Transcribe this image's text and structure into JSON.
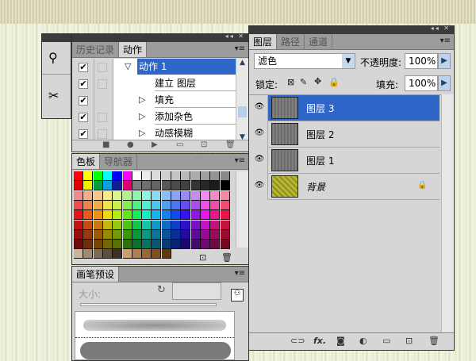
{
  "tools_strip": {
    "icons": [
      "usb-icon",
      "tools-icon"
    ]
  },
  "actions_panel": {
    "tabs": [
      {
        "label": "历史记录",
        "active": false
      },
      {
        "label": "动作",
        "active": true
      }
    ],
    "items": [
      {
        "label": "动作 1",
        "indent": 0,
        "expanded": true,
        "selected": true,
        "checked": true,
        "dialog": true
      },
      {
        "label": "建立 图层",
        "indent": 1,
        "expanded": null,
        "selected": false,
        "checked": true,
        "dialog": true
      },
      {
        "label": "填充",
        "indent": 1,
        "expanded": false,
        "selected": false,
        "checked": true,
        "dialog": false
      },
      {
        "label": "添加杂色",
        "indent": 1,
        "expanded": false,
        "selected": false,
        "checked": true,
        "dialog": true
      },
      {
        "label": "动感模糊",
        "indent": 1,
        "expanded": false,
        "selected": false,
        "checked": true,
        "dialog": true
      }
    ],
    "toolbar": [
      "stop-icon",
      "record-icon",
      "play-icon",
      "new-set-icon",
      "new-action-icon",
      "delete-icon"
    ]
  },
  "swatches_panel": {
    "tabs": [
      {
        "label": "色板",
        "active": true
      },
      {
        "label": "导航器",
        "active": false
      }
    ],
    "row1": [
      "#ff0000",
      "#ffff00",
      "#00ff00",
      "#00ffff",
      "#0000ff",
      "#ff00ff",
      "#ffffff",
      "#ececec",
      "#dcdcdc",
      "#d0d0d0",
      "#c4c4c4",
      "#b8b8b8",
      "#acacac",
      "#a0a0a0",
      "#949494",
      "#888888"
    ],
    "row2": [
      "#e00000",
      "#f0f000",
      "#00a040",
      "#10a0e0",
      "#102090",
      "#e0006e",
      "#7c7c7c",
      "#707070",
      "#646464",
      "#585858",
      "#4c4c4c",
      "#404040",
      "#343434",
      "#282828",
      "#1c1c1c",
      "#000000"
    ],
    "hues": [
      0,
      20,
      35,
      55,
      75,
      100,
      140,
      170,
      195,
      210,
      225,
      250,
      275,
      300,
      325,
      345
    ],
    "row_lightness": [
      75,
      62,
      50,
      42,
      32,
      24
    ],
    "browns": [
      "#c8b49a",
      "#a08a74",
      "#7a6a58",
      "#5c4e40",
      "#3c3028",
      "#c8a070",
      "#b08050",
      "#986838",
      "#7c5024",
      "#603810"
    ]
  },
  "brush_panel": {
    "tabs": [
      {
        "label": "画笔预设",
        "active": true
      }
    ],
    "size_label": "大小:"
  },
  "layers_panel": {
    "tabs": [
      {
        "label": "图层",
        "active": true
      },
      {
        "label": "路径",
        "active": false
      },
      {
        "label": "通道",
        "active": false
      }
    ],
    "blend_mode": "滤色",
    "opacity_label": "不透明度:",
    "opacity": "100%",
    "lock_label": "锁定:",
    "fill_label": "填充:",
    "fill": "100%",
    "layers": [
      {
        "name": "图层 3",
        "selected": true,
        "visible": true,
        "locked": false,
        "thumb": "#777777"
      },
      {
        "name": "图层 2",
        "selected": false,
        "visible": true,
        "locked": false,
        "thumb": "#777777"
      },
      {
        "name": "图层 1",
        "selected": false,
        "visible": true,
        "locked": false,
        "thumb": "#777777"
      },
      {
        "name": "背景",
        "selected": false,
        "visible": true,
        "locked": true,
        "thumb": "#9aa020"
      }
    ],
    "footer": [
      "link-icon",
      "fx-icon",
      "mask-icon",
      "adjustment-icon",
      "group-icon",
      "new-layer-icon",
      "trash-icon"
    ],
    "fx_label": "fx."
  },
  "colors": {
    "selection": "#2f66c8",
    "panel": "#d6d6d6",
    "header": "#3b3b3b"
  }
}
